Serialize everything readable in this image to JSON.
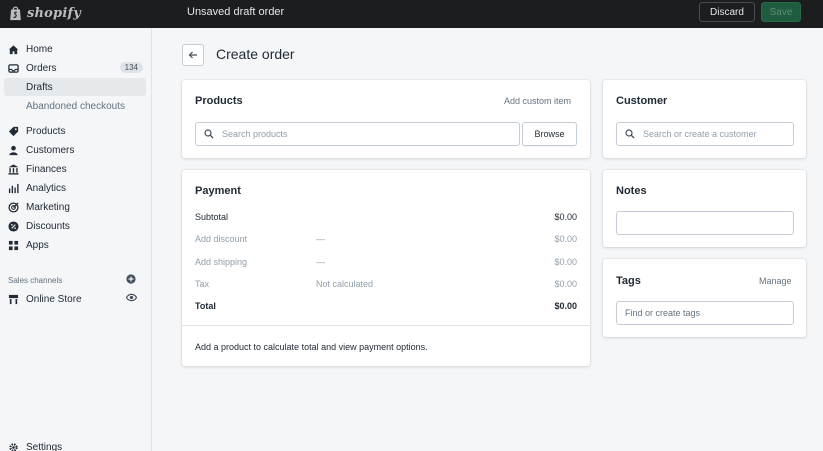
{
  "topbar": {
    "logo_text": "shopify",
    "title": "Unsaved draft order",
    "discard_label": "Discard",
    "save_label": "Save"
  },
  "sidebar": {
    "items": [
      {
        "label": "Home",
        "icon": "home-icon"
      },
      {
        "label": "Orders",
        "icon": "orders-icon",
        "badge": "134"
      },
      {
        "label": "Products",
        "icon": "tag-icon"
      },
      {
        "label": "Customers",
        "icon": "person-icon"
      },
      {
        "label": "Finances",
        "icon": "bank-icon"
      },
      {
        "label": "Analytics",
        "icon": "bar-chart-icon"
      },
      {
        "label": "Marketing",
        "icon": "target-icon"
      },
      {
        "label": "Discounts",
        "icon": "discount-icon"
      },
      {
        "label": "Apps",
        "icon": "apps-icon"
      }
    ],
    "sub_items": [
      {
        "label": "Drafts",
        "active": true
      },
      {
        "label": "Abandoned checkouts",
        "active": false
      }
    ],
    "sales_channels_label": "Sales channels",
    "online_store_label": "Online Store",
    "settings_label": "Settings"
  },
  "main": {
    "title": "Create order",
    "products": {
      "title": "Products",
      "add_custom_item": "Add custom item",
      "search_placeholder": "Search products",
      "browse_label": "Browse"
    },
    "payment": {
      "title": "Payment",
      "rows": [
        {
          "label": "Subtotal",
          "middle": "",
          "amount": "$0.00",
          "muted": false
        },
        {
          "label": "Add discount",
          "middle": "—",
          "amount": "$0.00",
          "muted": true
        },
        {
          "label": "Add shipping",
          "middle": "—",
          "amount": "$0.00",
          "muted": true
        },
        {
          "label": "Tax",
          "middle": "Not calculated",
          "amount": "$0.00",
          "muted": true
        },
        {
          "label": "Total",
          "middle": "",
          "amount": "$0.00",
          "muted": false
        }
      ],
      "footer": "Add a product to calculate total and view payment options."
    },
    "customer": {
      "title": "Customer",
      "search_placeholder": "Search or create a customer"
    },
    "notes": {
      "title": "Notes"
    },
    "tags": {
      "title": "Tags",
      "manage_label": "Manage",
      "placeholder": "Find or create tags"
    }
  },
  "colors": {
    "topbar_bg": "#1c1d1f",
    "save_button": "#1f5c3f",
    "page_bg": "#f4f6f8"
  }
}
